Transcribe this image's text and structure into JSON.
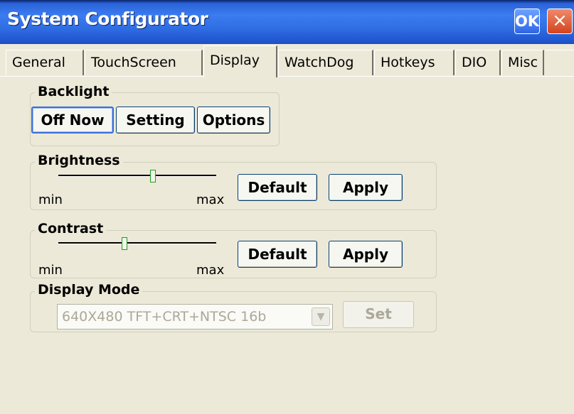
{
  "window": {
    "title": "System Configurator",
    "ok_label": "OK",
    "close_label": "×"
  },
  "tabs": [
    {
      "label": "General",
      "active": false
    },
    {
      "label": "TouchScreen",
      "active": false
    },
    {
      "label": "Display",
      "active": true
    },
    {
      "label": "WatchDog",
      "active": false
    },
    {
      "label": "Hotkeys",
      "active": false
    },
    {
      "label": "DIO",
      "active": false
    },
    {
      "label": "Misc",
      "active": false
    }
  ],
  "backlight": {
    "label": "Backlight",
    "off_now": "Off Now",
    "setting": "Setting",
    "options": "Options"
  },
  "brightness": {
    "label": "Brightness",
    "min": "min",
    "max": "max",
    "level": 0.6,
    "default_label": "Default",
    "apply_label": "Apply"
  },
  "contrast": {
    "label": "Contrast",
    "min": "min",
    "max": "max",
    "level": 0.42,
    "default_label": "Default",
    "apply_label": "Apply"
  },
  "display_mode": {
    "label": "Display Mode",
    "selected": "640X480 TFT+CRT+NTSC 16b",
    "set_label": "Set",
    "arrow_icon": "chevron-down-icon"
  }
}
